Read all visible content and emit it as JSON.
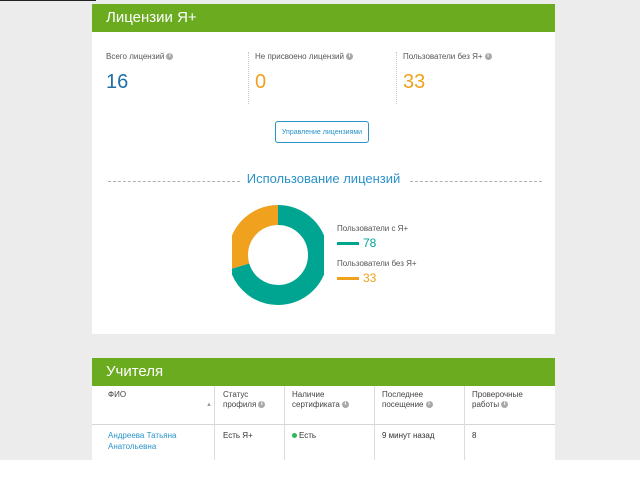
{
  "licenses": {
    "title": "Лицензии Я+",
    "stats": [
      {
        "label": "Всего лицензий",
        "value": "16",
        "color": "#1f6fa8"
      },
      {
        "label": "Не присвоено лицензий",
        "value": "0",
        "color": "#f0a21e"
      },
      {
        "label": "Пользователи без Я+",
        "value": "33",
        "color": "#f0a21e"
      }
    ],
    "manage_button": "Управление лицензиями",
    "usage_title": "Использование лицензий",
    "legend": [
      {
        "label": "Пользователи с Я+",
        "value": "78",
        "color": "#00a591"
      },
      {
        "label": "Пользователи без Я+",
        "value": "33",
        "color": "#f0a21e"
      }
    ]
  },
  "chart_data": {
    "type": "pie",
    "categories": [
      "Пользователи с Я+",
      "Пользователи без Я+"
    ],
    "values": [
      78,
      33
    ],
    "colors": [
      "#00a591",
      "#f0a21e"
    ],
    "title": "Использование лицензий"
  },
  "teachers": {
    "title": "Учителя",
    "columns": [
      {
        "l1": "ФИО",
        "l2": ""
      },
      {
        "l1": "Статус",
        "l2": "профиля"
      },
      {
        "l1": "Наличие",
        "l2": "сертификата"
      },
      {
        "l1": "Последнее",
        "l2": "посещение"
      },
      {
        "l1": "Проверочные",
        "l2": "работы"
      }
    ],
    "rows": [
      {
        "name_l1": "Андреева Татьяна",
        "name_l2": "Анатольевна",
        "status": "Есть Я+",
        "certificate": "Есть",
        "last_visit": "9 минут назад",
        "works": "8"
      }
    ]
  }
}
